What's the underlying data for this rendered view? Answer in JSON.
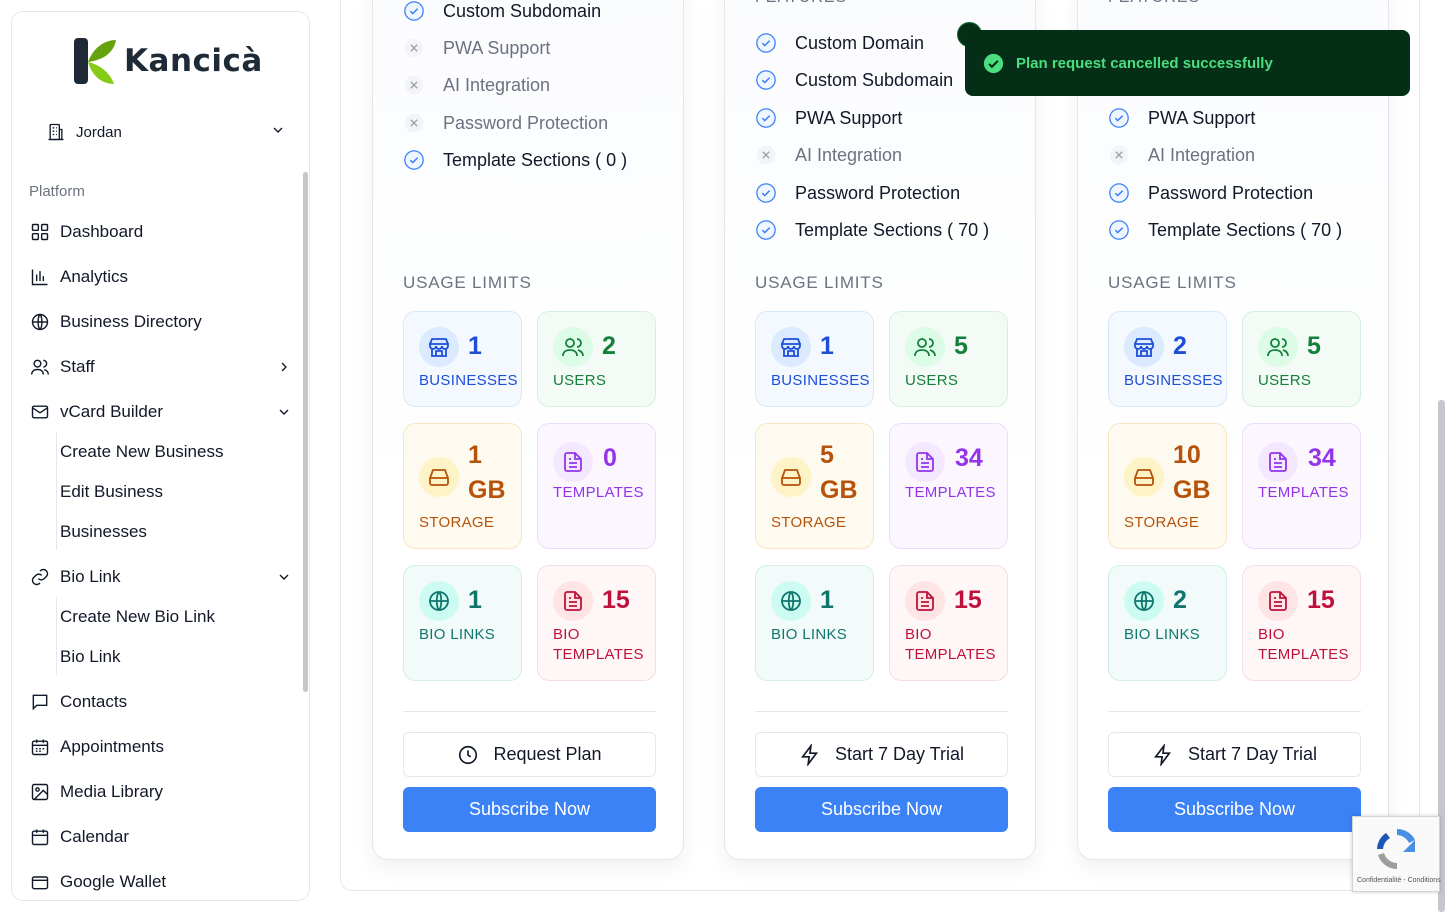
{
  "brand": {
    "name": "Kancicà"
  },
  "org": {
    "name": "Jordan"
  },
  "sidebar": {
    "section": "Platform",
    "items": [
      {
        "label": "Dashboard"
      },
      {
        "label": "Analytics"
      },
      {
        "label": "Business Directory"
      },
      {
        "label": "Staff"
      },
      {
        "label": "vCard Builder"
      },
      {
        "label": "Bio Link"
      },
      {
        "label": "Contacts"
      },
      {
        "label": "Appointments"
      },
      {
        "label": "Media Library"
      },
      {
        "label": "Calendar"
      },
      {
        "label": "Google Wallet"
      }
    ],
    "vcard_sub": [
      "Create New Business",
      "Edit Business",
      "Businesses"
    ],
    "biolink_sub": [
      "Create New Bio Link",
      "Bio Link"
    ]
  },
  "plans": [
    {
      "features_heading": "",
      "features": [
        {
          "label": "Custom Subdomain",
          "enabled": true
        },
        {
          "label": "PWA Support",
          "enabled": false
        },
        {
          "label": "AI Integration",
          "enabled": false
        },
        {
          "label": "Password Protection",
          "enabled": false
        },
        {
          "label": "Template Sections ( 0 )",
          "enabled": true
        }
      ],
      "usage_label": "USAGE LIMITS",
      "limits": {
        "businesses": {
          "value": "1",
          "label": "BUSINESSES"
        },
        "users": {
          "value": "2",
          "label": "USERS"
        },
        "storage": {
          "value": "1",
          "unit": "GB",
          "label": "STORAGE"
        },
        "templates": {
          "value": "0",
          "label": "TEMPLATES"
        },
        "bio_links": {
          "value": "1",
          "label": "BIO LINKS"
        },
        "bio_templates": {
          "value": "15",
          "label1": "BIO",
          "label2": "TEMPLATES"
        }
      },
      "secondary_button": "Request Plan",
      "primary_button": "Subscribe Now"
    },
    {
      "features_heading": "FEATURES",
      "features": [
        {
          "label": "Custom Domain",
          "enabled": true
        },
        {
          "label": "Custom Subdomain",
          "enabled": true
        },
        {
          "label": "PWA Support",
          "enabled": true
        },
        {
          "label": "AI Integration",
          "enabled": false
        },
        {
          "label": "Password Protection",
          "enabled": true
        },
        {
          "label": "Template Sections ( 70 )",
          "enabled": true
        }
      ],
      "usage_label": "USAGE LIMITS",
      "limits": {
        "businesses": {
          "value": "1",
          "label": "BUSINESSES"
        },
        "users": {
          "value": "5",
          "label": "USERS"
        },
        "storage": {
          "value": "5",
          "unit": "GB",
          "label": "STORAGE"
        },
        "templates": {
          "value": "34",
          "label": "TEMPLATES"
        },
        "bio_links": {
          "value": "1",
          "label": "BIO LINKS"
        },
        "bio_templates": {
          "value": "15",
          "label1": "BIO",
          "label2": "TEMPLATES"
        }
      },
      "secondary_button": "Start 7 Day Trial",
      "primary_button": "Subscribe Now"
    },
    {
      "features_heading": "FEATURES",
      "features": [
        {
          "label": "PWA Support",
          "enabled": true
        },
        {
          "label": "AI Integration",
          "enabled": false
        },
        {
          "label": "Password Protection",
          "enabled": true
        },
        {
          "label": "Template Sections ( 70 )",
          "enabled": true
        }
      ],
      "usage_label": "USAGE LIMITS",
      "limits": {
        "businesses": {
          "value": "2",
          "label": "BUSINESSES"
        },
        "users": {
          "value": "5",
          "label": "USERS"
        },
        "storage": {
          "value": "10",
          "unit": "GB",
          "label": "STORAGE"
        },
        "templates": {
          "value": "34",
          "label": "TEMPLATES"
        },
        "bio_links": {
          "value": "2",
          "label": "BIO LINKS"
        },
        "bio_templates": {
          "value": "15",
          "label1": "BIO",
          "label2": "TEMPLATES"
        }
      },
      "secondary_button": "Start 7 Day Trial",
      "primary_button": "Subscribe Now"
    }
  ],
  "toast": {
    "message": "Plan request cancelled successfully"
  },
  "recaptcha": {
    "text": "Confidentialité - Conditions"
  },
  "colors": {
    "primary": "#3b82f6",
    "toast_bg": "#052e16",
    "toast_text": "#4ade80",
    "blue": "#1d4ed8",
    "green": "#15803d",
    "orange": "#b45309",
    "purple": "#9333ea",
    "teal": "#0f766e",
    "rose": "#be123c"
  }
}
